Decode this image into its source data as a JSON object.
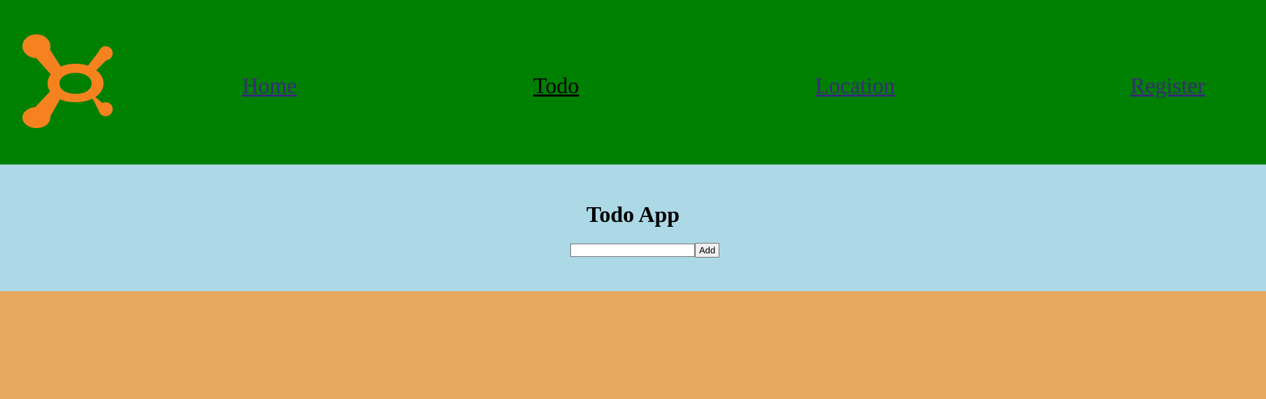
{
  "header": {
    "logo_icon": "orangetheory-splat-logo-icon",
    "logo_color": "#f5821f",
    "background": "#008000",
    "nav": {
      "home": "Home",
      "todo": "Todo",
      "location": "Location",
      "register": "Register"
    },
    "active_nav": "Todo"
  },
  "main": {
    "title": "Todo App",
    "input_value": "",
    "add_label": "Add",
    "background": "#add8e6"
  },
  "footer": {
    "background": "#e8a85f"
  }
}
